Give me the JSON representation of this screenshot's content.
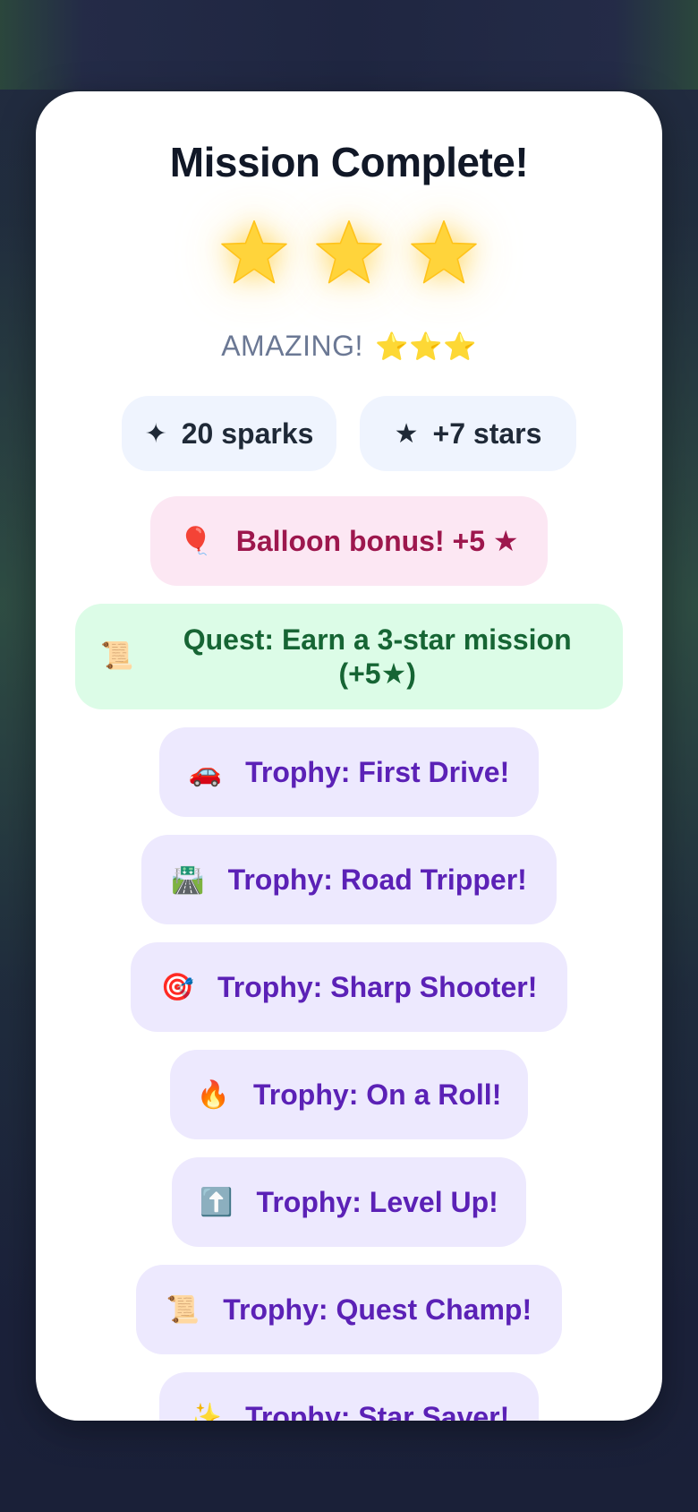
{
  "title": "Mission Complete!",
  "stars": {
    "earned": 3,
    "total": 3,
    "color": "#FFD43B"
  },
  "verdict": {
    "text": "AMAZING!",
    "mini_stars": "⭐⭐⭐"
  },
  "rewards": {
    "sparks": {
      "icon": "sparkle-icon",
      "glyph": "✦",
      "label": "20 sparks"
    },
    "stars": {
      "icon": "star-icon",
      "glyph": "★",
      "label": "+7 stars"
    }
  },
  "bonuses": [
    {
      "emoji": "🎈",
      "icon": "balloon-icon",
      "label": "Balloon bonus! +5 ★"
    }
  ],
  "quest": {
    "emoji": "📜",
    "icon": "scroll-icon",
    "label": "Quest: Earn a 3-star mission (+5★)"
  },
  "trophies": [
    {
      "emoji": "🚗",
      "icon": "car-icon",
      "label": "Trophy: First Drive!"
    },
    {
      "emoji": "🛣️",
      "icon": "road-icon",
      "label": "Trophy: Road Tripper!"
    },
    {
      "emoji": "🎯",
      "icon": "target-icon",
      "label": "Trophy: Sharp Shooter!"
    },
    {
      "emoji": "🔥",
      "icon": "fire-icon",
      "label": "Trophy: On a Roll!"
    },
    {
      "emoji": "⬆️",
      "icon": "up-arrow-icon",
      "label": "Trophy: Level Up!"
    },
    {
      "emoji": "📜",
      "icon": "scroll-icon",
      "label": "Trophy: Quest Champ!"
    },
    {
      "emoji": "✨",
      "icon": "sparkles-icon",
      "label": "Trophy: Star Saver!"
    }
  ],
  "colors": {
    "card_bg": "#FFFFFF",
    "pill_bg": "#EFF4FE",
    "bonus_bg": "#FCE7F3",
    "bonus_text": "#9D174D",
    "quest_bg": "#DCFCE7",
    "quest_text": "#166534",
    "trophy_bg": "#EDE9FE",
    "trophy_text": "#5B21B6"
  }
}
